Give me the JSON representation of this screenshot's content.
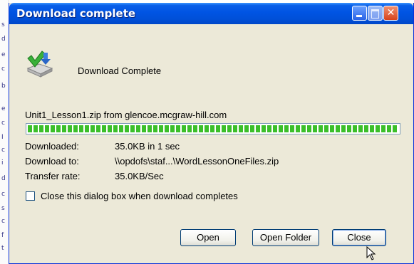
{
  "background_window": {
    "letters": [
      "s",
      "d",
      "e",
      "c",
      "b",
      "e",
      "c",
      "I",
      "c",
      "i",
      "d",
      "c",
      "s",
      "c",
      "f",
      "t"
    ]
  },
  "window": {
    "title": "Download complete",
    "titlebar_color": "#0054e3",
    "body_color": "#ece9d8"
  },
  "status": {
    "icon": "download-complete-icon",
    "label": "Download Complete"
  },
  "source_line": "Unit1_Lesson1.zip from glencoe.mcgraw-hill.com",
  "progress": {
    "value": 1.0,
    "color": "#3bbf2a"
  },
  "info": [
    {
      "label": "Downloaded:",
      "value": "35.0KB in 1 sec"
    },
    {
      "label": "Download to:",
      "value": "\\\\opdofs\\staf...\\WordLessonOneFiles.zip"
    },
    {
      "label": "Transfer rate:",
      "value": "35.0KB/Sec"
    }
  ],
  "close_when_done": {
    "checked": false,
    "label": "Close this dialog box when download completes"
  },
  "buttons": {
    "open": "Open",
    "open_folder": "Open Folder",
    "close": "Close"
  }
}
